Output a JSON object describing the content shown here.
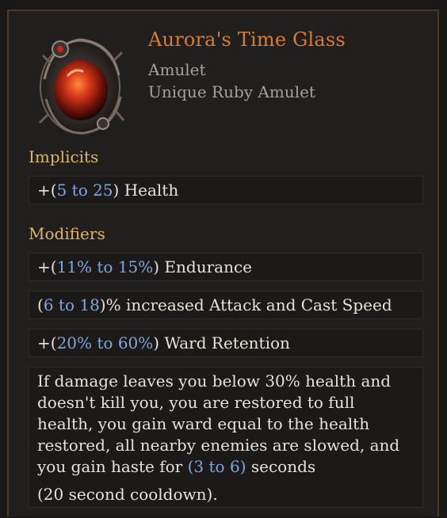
{
  "item": {
    "name": "Aurora's Time Glass",
    "type": "Amulet",
    "base": "Unique Ruby Amulet",
    "icon": "ruby-amulet-icon",
    "name_color": "#d97b32"
  },
  "implicits": {
    "title": "Implicits",
    "mods": [
      {
        "prefix": "+(",
        "min": "5",
        "to": " to ",
        "max": "25",
        "suffix": ") Health"
      }
    ]
  },
  "modifiers": {
    "title": "Modifiers",
    "mods": [
      {
        "prefix": "+(",
        "min": "11%",
        "to": " to ",
        "max": "15%",
        "suffix": ") Endurance"
      },
      {
        "prefix": "(",
        "min": "6",
        "to": " to ",
        "max": "18",
        "suffix": ")% increased Attack and Cast Speed"
      },
      {
        "prefix": "+(",
        "min": "20%",
        "to": " to ",
        "max": "60%",
        "suffix": ") Ward Retention"
      }
    ],
    "unique_mod": {
      "text": "If damage leaves you below 30% health and doesn't kill you, you are restored to full health, you gain ward equal to the health restored, all nearby enemies are slowed, and you gain haste for ",
      "open": "(",
      "min": "3",
      "to": " to ",
      "max": "6",
      "close": ")",
      "after": " seconds",
      "cooldown": "(20 second cooldown)."
    }
  },
  "colors": {
    "section_title": "#e1b567",
    "value_range": "#7fa6e0",
    "mod_text": "#e8e2d8"
  }
}
